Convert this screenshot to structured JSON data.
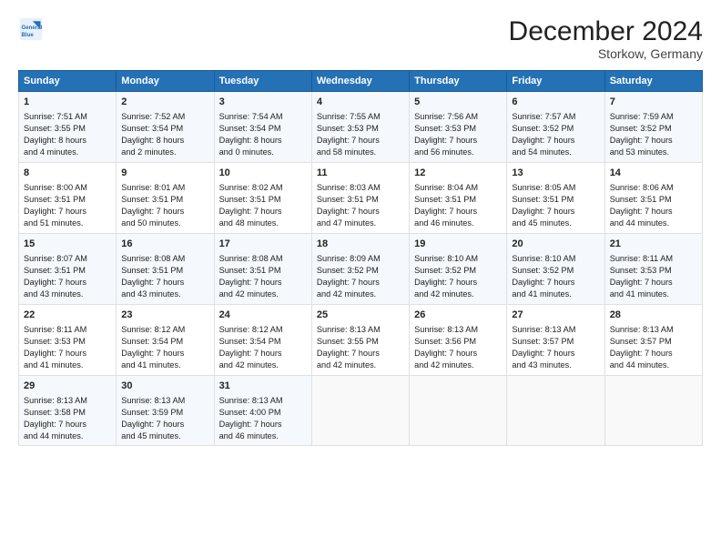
{
  "logo": {
    "line1": "General",
    "line2": "Blue"
  },
  "title": "December 2024",
  "subtitle": "Storkow, Germany",
  "days_header": [
    "Sunday",
    "Monday",
    "Tuesday",
    "Wednesday",
    "Thursday",
    "Friday",
    "Saturday"
  ],
  "weeks": [
    [
      {
        "day": "1",
        "info": "Sunrise: 7:51 AM\nSunset: 3:55 PM\nDaylight: 8 hours\nand 4 minutes."
      },
      {
        "day": "2",
        "info": "Sunrise: 7:52 AM\nSunset: 3:54 PM\nDaylight: 8 hours\nand 2 minutes."
      },
      {
        "day": "3",
        "info": "Sunrise: 7:54 AM\nSunset: 3:54 PM\nDaylight: 8 hours\nand 0 minutes."
      },
      {
        "day": "4",
        "info": "Sunrise: 7:55 AM\nSunset: 3:53 PM\nDaylight: 7 hours\nand 58 minutes."
      },
      {
        "day": "5",
        "info": "Sunrise: 7:56 AM\nSunset: 3:53 PM\nDaylight: 7 hours\nand 56 minutes."
      },
      {
        "day": "6",
        "info": "Sunrise: 7:57 AM\nSunset: 3:52 PM\nDaylight: 7 hours\nand 54 minutes."
      },
      {
        "day": "7",
        "info": "Sunrise: 7:59 AM\nSunset: 3:52 PM\nDaylight: 7 hours\nand 53 minutes."
      }
    ],
    [
      {
        "day": "8",
        "info": "Sunrise: 8:00 AM\nSunset: 3:51 PM\nDaylight: 7 hours\nand 51 minutes."
      },
      {
        "day": "9",
        "info": "Sunrise: 8:01 AM\nSunset: 3:51 PM\nDaylight: 7 hours\nand 50 minutes."
      },
      {
        "day": "10",
        "info": "Sunrise: 8:02 AM\nSunset: 3:51 PM\nDaylight: 7 hours\nand 48 minutes."
      },
      {
        "day": "11",
        "info": "Sunrise: 8:03 AM\nSunset: 3:51 PM\nDaylight: 7 hours\nand 47 minutes."
      },
      {
        "day": "12",
        "info": "Sunrise: 8:04 AM\nSunset: 3:51 PM\nDaylight: 7 hours\nand 46 minutes."
      },
      {
        "day": "13",
        "info": "Sunrise: 8:05 AM\nSunset: 3:51 PM\nDaylight: 7 hours\nand 45 minutes."
      },
      {
        "day": "14",
        "info": "Sunrise: 8:06 AM\nSunset: 3:51 PM\nDaylight: 7 hours\nand 44 minutes."
      }
    ],
    [
      {
        "day": "15",
        "info": "Sunrise: 8:07 AM\nSunset: 3:51 PM\nDaylight: 7 hours\nand 43 minutes."
      },
      {
        "day": "16",
        "info": "Sunrise: 8:08 AM\nSunset: 3:51 PM\nDaylight: 7 hours\nand 43 minutes."
      },
      {
        "day": "17",
        "info": "Sunrise: 8:08 AM\nSunset: 3:51 PM\nDaylight: 7 hours\nand 42 minutes."
      },
      {
        "day": "18",
        "info": "Sunrise: 8:09 AM\nSunset: 3:52 PM\nDaylight: 7 hours\nand 42 minutes."
      },
      {
        "day": "19",
        "info": "Sunrise: 8:10 AM\nSunset: 3:52 PM\nDaylight: 7 hours\nand 42 minutes."
      },
      {
        "day": "20",
        "info": "Sunrise: 8:10 AM\nSunset: 3:52 PM\nDaylight: 7 hours\nand 41 minutes."
      },
      {
        "day": "21",
        "info": "Sunrise: 8:11 AM\nSunset: 3:53 PM\nDaylight: 7 hours\nand 41 minutes."
      }
    ],
    [
      {
        "day": "22",
        "info": "Sunrise: 8:11 AM\nSunset: 3:53 PM\nDaylight: 7 hours\nand 41 minutes."
      },
      {
        "day": "23",
        "info": "Sunrise: 8:12 AM\nSunset: 3:54 PM\nDaylight: 7 hours\nand 41 minutes."
      },
      {
        "day": "24",
        "info": "Sunrise: 8:12 AM\nSunset: 3:54 PM\nDaylight: 7 hours\nand 42 minutes."
      },
      {
        "day": "25",
        "info": "Sunrise: 8:13 AM\nSunset: 3:55 PM\nDaylight: 7 hours\nand 42 minutes."
      },
      {
        "day": "26",
        "info": "Sunrise: 8:13 AM\nSunset: 3:56 PM\nDaylight: 7 hours\nand 42 minutes."
      },
      {
        "day": "27",
        "info": "Sunrise: 8:13 AM\nSunset: 3:57 PM\nDaylight: 7 hours\nand 43 minutes."
      },
      {
        "day": "28",
        "info": "Sunrise: 8:13 AM\nSunset: 3:57 PM\nDaylight: 7 hours\nand 44 minutes."
      }
    ],
    [
      {
        "day": "29",
        "info": "Sunrise: 8:13 AM\nSunset: 3:58 PM\nDaylight: 7 hours\nand 44 minutes."
      },
      {
        "day": "30",
        "info": "Sunrise: 8:13 AM\nSunset: 3:59 PM\nDaylight: 7 hours\nand 45 minutes."
      },
      {
        "day": "31",
        "info": "Sunrise: 8:13 AM\nSunset: 4:00 PM\nDaylight: 7 hours\nand 46 minutes."
      },
      {
        "day": "",
        "info": ""
      },
      {
        "day": "",
        "info": ""
      },
      {
        "day": "",
        "info": ""
      },
      {
        "day": "",
        "info": ""
      }
    ]
  ]
}
